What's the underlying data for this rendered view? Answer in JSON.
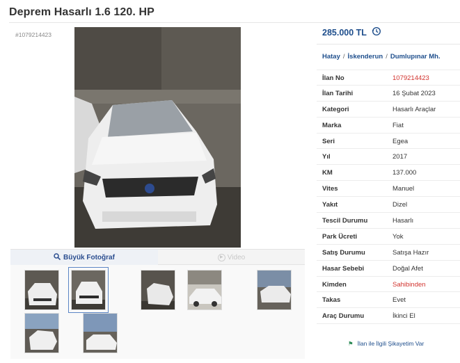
{
  "listing": {
    "title": "Deprem Hasarlı 1.6 120. HP",
    "id_small": "#1079214423",
    "price": "285.000 TL",
    "location": {
      "city": "Hatay",
      "district": "İskenderun",
      "neighborhood": "Dumlupınar Mh."
    }
  },
  "gallery": {
    "big_photo_label": "Büyük Fotoğraf",
    "video_label": "Video",
    "thumbnail_count": 7
  },
  "attributes": [
    {
      "key": "İlan No",
      "value": "1079214423",
      "highlight": true
    },
    {
      "key": "İlan Tarihi",
      "value": "16 Şubat 2023",
      "highlight": false
    },
    {
      "key": "Kategori",
      "value": "Hasarlı Araçlar",
      "highlight": false
    },
    {
      "key": "Marka",
      "value": "Fiat",
      "highlight": false
    },
    {
      "key": "Seri",
      "value": "Egea",
      "highlight": false
    },
    {
      "key": "Yıl",
      "value": "2017",
      "highlight": false
    },
    {
      "key": "KM",
      "value": "137.000",
      "highlight": false
    },
    {
      "key": "Vites",
      "value": "Manuel",
      "highlight": false
    },
    {
      "key": "Yakıt",
      "value": "Dizel",
      "highlight": false
    },
    {
      "key": "Tescil Durumu",
      "value": "Hasarlı",
      "highlight": false
    },
    {
      "key": "Park Ücreti",
      "value": "Yok",
      "highlight": false
    },
    {
      "key": "Satış Durumu",
      "value": "Satışa Hazır",
      "highlight": false
    },
    {
      "key": "Hasar Sebebi",
      "value": "Doğal Afet",
      "highlight": false
    },
    {
      "key": "Kimden",
      "value": "Sahibinden",
      "highlight": true
    },
    {
      "key": "Takas",
      "value": "Evet",
      "highlight": false
    },
    {
      "key": "Araç Durumu",
      "value": "İkinci El",
      "highlight": false
    }
  ],
  "complaint_link": "İlan ile İlgili Şikayetim Var",
  "colors": {
    "brand_blue": "#1e4e8c",
    "highlight_red": "#d2322d"
  },
  "icons": {
    "price_history": "history-icon",
    "big_photo": "magnifier-icon",
    "video": "play-icon",
    "complaint": "flag-icon"
  }
}
